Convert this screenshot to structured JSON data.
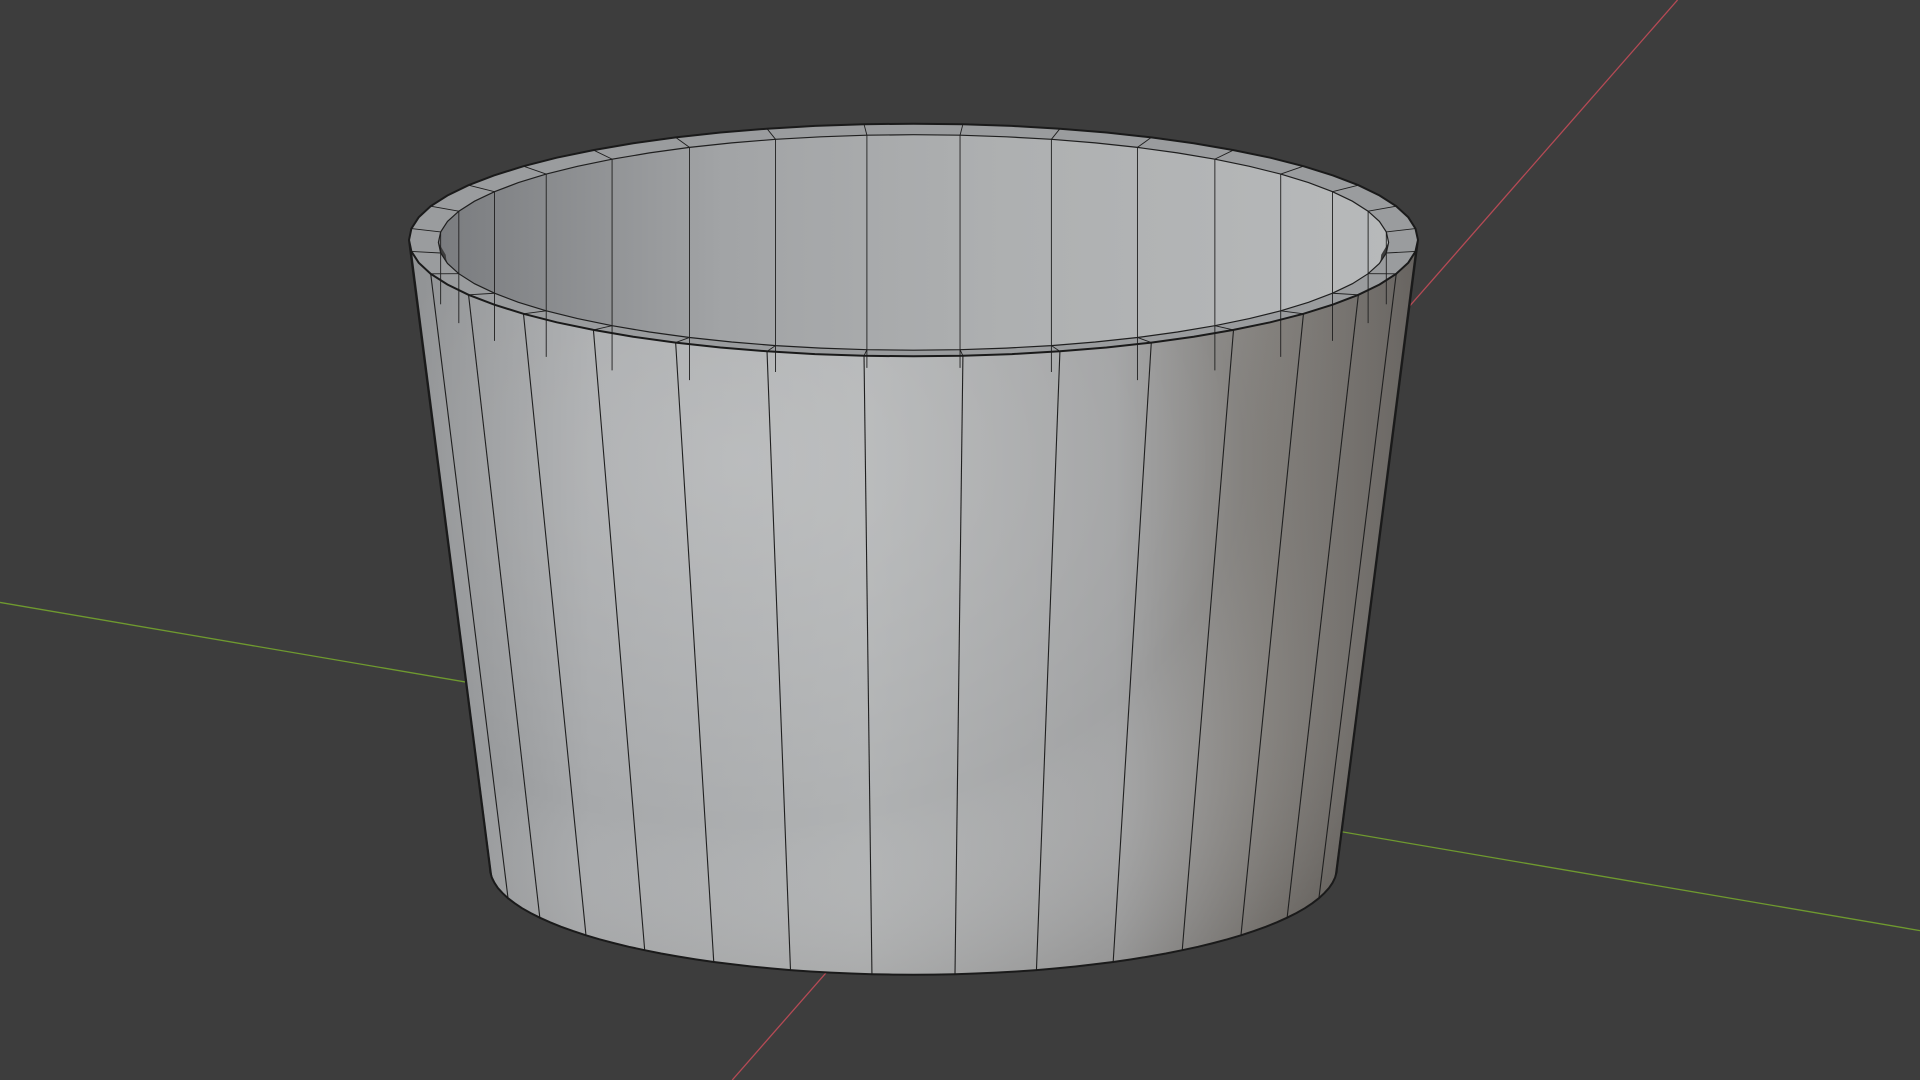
{
  "viewport": {
    "background_color": "#3d3d3d",
    "shading": "solid",
    "wireframe_overlay": true
  },
  "axes": {
    "x_axis_color": "#b54a55",
    "y_axis_color": "#6f9a2f"
  },
  "object": {
    "type": "hollow-cylinder-mesh",
    "segments": 32,
    "base_color": "#a6a8aa",
    "edge_color": "#1f1f1f"
  }
}
